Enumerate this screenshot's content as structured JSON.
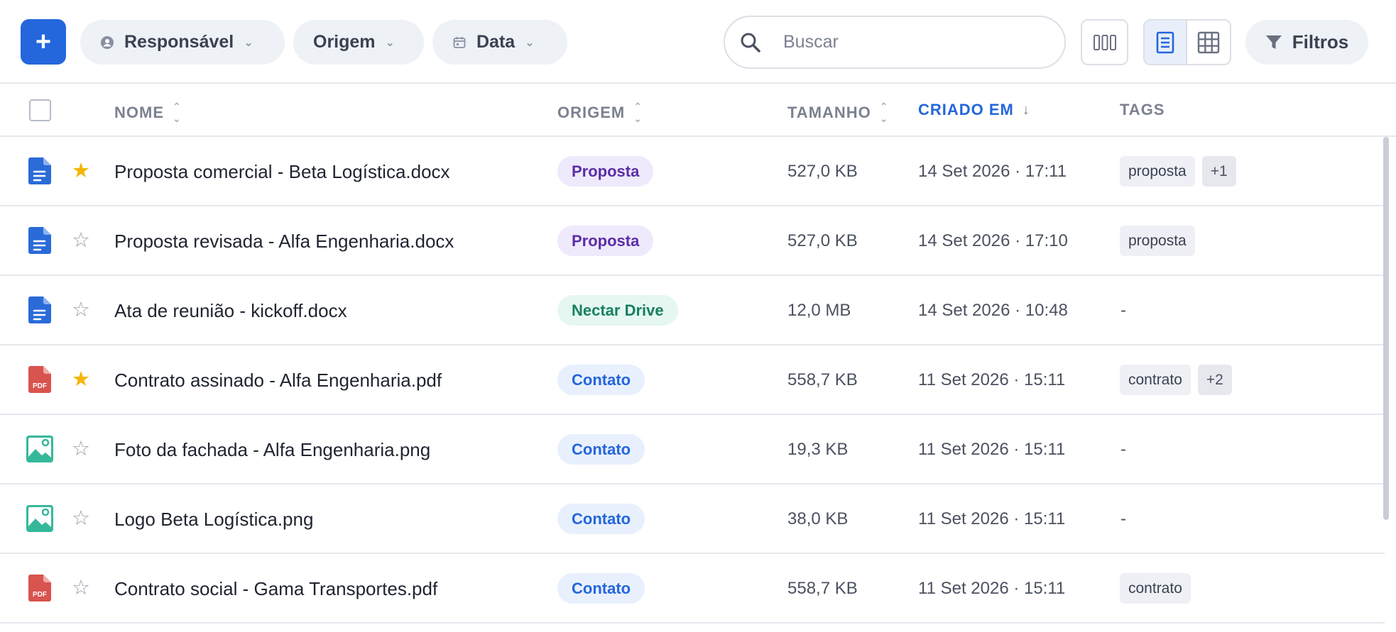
{
  "toolbar": {
    "filter_responsavel": "Responsável",
    "filter_origem": "Origem",
    "filter_data": "Data",
    "search_placeholder": "Buscar",
    "filters_label": "Filtros",
    "icons": {
      "add": "plus-icon",
      "responsavel": "user-icon",
      "data": "calendar-icon",
      "chevron": "chevron-down-icon",
      "search": "search-icon",
      "columns": "columns-icon",
      "list": "list-view-icon",
      "grid": "grid-view-icon",
      "filter": "filter-icon"
    },
    "active_view": "list"
  },
  "table": {
    "headers": {
      "nome": "NOME",
      "origem": "ORIGEM",
      "tamanho": "TAMANHO",
      "criado_em": "CRIADO EM",
      "tags": "TAGS"
    },
    "sort": {
      "column": "criado_em",
      "direction": "desc"
    },
    "rows": [
      {
        "type": "doc",
        "starred": true,
        "name": "Proposta comercial - Beta Logística.docx",
        "origem": "Proposta",
        "origem_kind": "proposta",
        "size": "527,0 KB",
        "date": "14 Set 2026 · 17:11",
        "tags": [
          "proposta"
        ],
        "more": "+1"
      },
      {
        "type": "doc",
        "starred": false,
        "name": "Proposta revisada - Alfa Engenharia.docx",
        "origem": "Proposta",
        "origem_kind": "proposta",
        "size": "527,0 KB",
        "date": "14 Set 2026 · 17:10",
        "tags": [
          "proposta"
        ],
        "more": ""
      },
      {
        "type": "doc",
        "starred": false,
        "name": "Ata de reunião - kickoff.docx",
        "origem": "Nectar Drive",
        "origem_kind": "drive",
        "size": "12,0 MB",
        "date": "14 Set 2026 · 10:48",
        "tags": [],
        "more": "",
        "empty": "-"
      },
      {
        "type": "pdf",
        "starred": true,
        "name": "Contrato assinado - Alfa Engenharia.pdf",
        "origem": "Contato",
        "origem_kind": "contato",
        "size": "558,7 KB",
        "date": "11 Set 2026 · 15:11",
        "tags": [
          "contrato"
        ],
        "more": "+2"
      },
      {
        "type": "image",
        "starred": false,
        "name": "Foto da fachada - Alfa Engenharia.png",
        "origem": "Contato",
        "origem_kind": "contato",
        "size": "19,3 KB",
        "date": "11 Set 2026 · 15:11",
        "tags": [],
        "more": "",
        "empty": "-"
      },
      {
        "type": "image",
        "starred": false,
        "name": "Logo Beta Logística.png",
        "origem": "Contato",
        "origem_kind": "contato",
        "size": "38,0 KB",
        "date": "11 Set 2026 · 15:11",
        "tags": [],
        "more": "",
        "empty": "-"
      },
      {
        "type": "pdf",
        "starred": false,
        "name": "Contrato social - Gama Transportes.pdf",
        "origem": "Contato",
        "origem_kind": "contato",
        "size": "558,7 KB",
        "date": "11 Set 2026 · 15:11",
        "tags": [
          "contrato"
        ],
        "more": ""
      }
    ]
  },
  "icon_labels": {
    "pdf": "PDF"
  },
  "colors": {
    "accent": "#2466dc",
    "star": "#f5b400",
    "doc_icon": "#2a6bd8",
    "pdf_icon": "#d9534f",
    "image_icon": "#35b89a"
  }
}
